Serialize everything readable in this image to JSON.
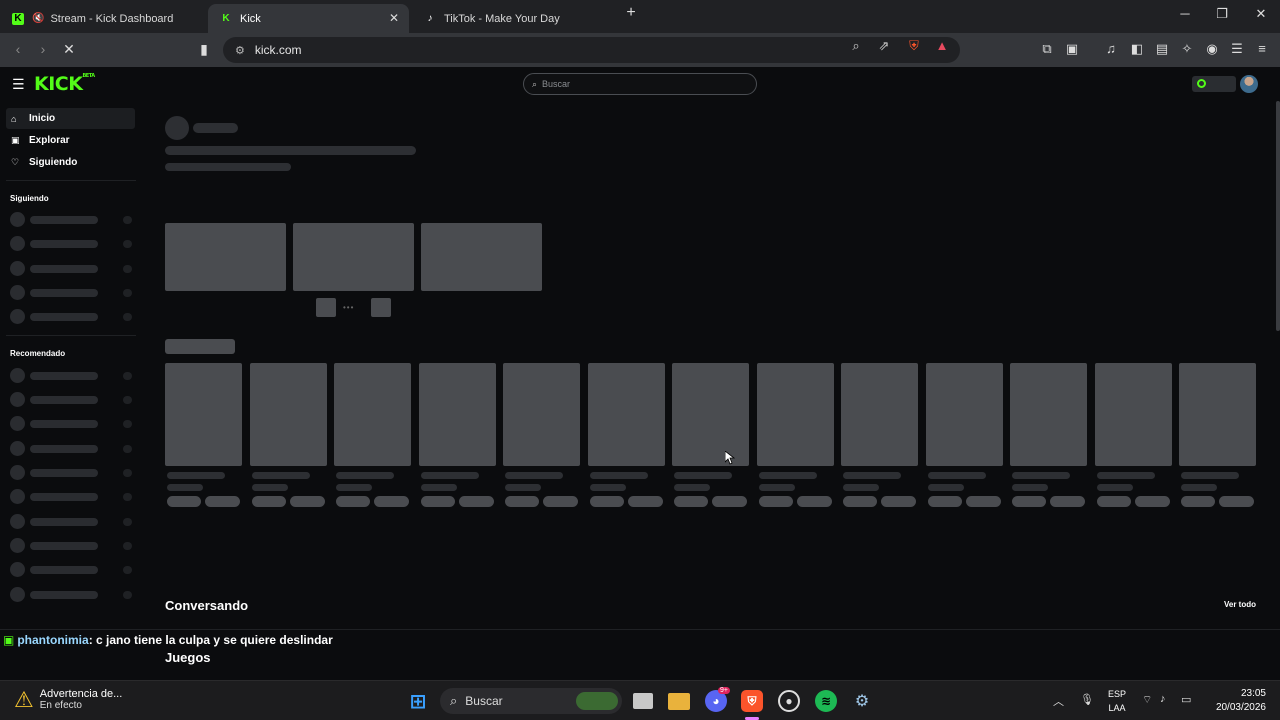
{
  "browser": {
    "tabs": [
      {
        "title": "Stream - Kick Dashboard",
        "favicon": "kick-logo-icon",
        "muted": true
      },
      {
        "title": "Kick",
        "favicon": "kick-logo-icon",
        "active": true
      },
      {
        "title": "TikTok - Make Your Day",
        "favicon": "tiktok-icon"
      }
    ],
    "new_tab": "+",
    "url": "kick.com"
  },
  "kick": {
    "logo": "KICK",
    "logo_badge": "BETA",
    "search_placeholder": "Buscar",
    "accent": "#53fc18"
  },
  "sidebar": {
    "nav": [
      {
        "label": "Inicio",
        "icon": "home-icon",
        "active": true
      },
      {
        "label": "Explorar",
        "icon": "compass-icon"
      },
      {
        "label": "Siguiendo",
        "icon": "heart-icon"
      }
    ],
    "section_following": "Siguiendo",
    "section_recommended": "Recomendado"
  },
  "main": {
    "conversando": "Conversando",
    "ver_todo": "Ver todo",
    "juegos": "Juegos"
  },
  "chat_overlay": {
    "user": "phantonimia",
    "message": ": c jano tiene la culpa y se quiere deslindar"
  },
  "taskbar": {
    "warning_title": "Advertencia de...",
    "warning_sub": "En efecto",
    "search_label": "Buscar",
    "discord_badge": "9+",
    "lang_line1": "ESP",
    "lang_line2": "LAA",
    "time": "23:05",
    "date": "20/03/2026"
  }
}
